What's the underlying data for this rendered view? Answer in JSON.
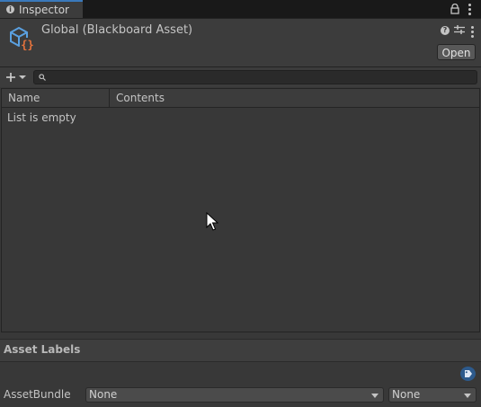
{
  "window": {
    "tab_label": "Inspector"
  },
  "header": {
    "title": "Global (Blackboard Asset)",
    "open_label": "Open"
  },
  "toolbar": {
    "search_placeholder": ""
  },
  "list": {
    "columns": [
      "Name",
      "Contents"
    ],
    "empty_text": "List is empty"
  },
  "asset_labels": {
    "title": "Asset Labels",
    "bundle_label": "AssetBundle",
    "bundle_value": "None",
    "variant_value": "None"
  },
  "colors": {
    "accent": "#3a79bb",
    "asset_icon_blue": "#5aa0e0",
    "asset_icon_orange": "#e8743c",
    "tag": "#2d5a8c"
  },
  "icons": [
    "info-icon",
    "lock-icon",
    "kebab-menu-icon",
    "blackboard-asset-icon",
    "help-icon",
    "settings-icon",
    "plus-icon",
    "search-icon",
    "tag-icon",
    "cursor-icon"
  ]
}
